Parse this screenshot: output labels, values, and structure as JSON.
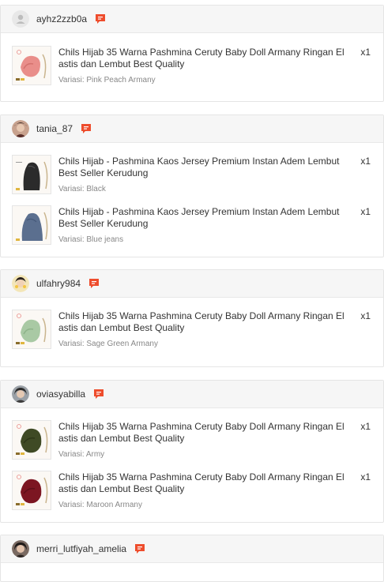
{
  "orders": [
    {
      "user": "ayhz2zzb0a",
      "avatar": "default-avatar",
      "items": [
        {
          "title": "Chils Hijab 35 Warna Pashmina Ceruty Baby Doll Armany Ringan El astis dan Lembut Best Quality",
          "variant": "Variasi: Pink Peach Armany",
          "qty": "x1",
          "color": "#e98e8a"
        }
      ]
    },
    {
      "user": "tania_87",
      "avatar": "photo-avatar",
      "items": [
        {
          "title": "Chils Hijab - Pashmina Kaos Jersey Premium Instan Adem Lembut Best Seller Kerudung",
          "variant": "Variasi: Black",
          "qty": "x1",
          "color": "#2b2b2b"
        },
        {
          "title": "Chils Hijab - Pashmina Kaos Jersey Premium Instan Adem Lembut Best Seller Kerudung",
          "variant": "Variasi: Blue jeans",
          "qty": "x1",
          "color": "#5b6f8f"
        }
      ]
    },
    {
      "user": "ulfahry984",
      "avatar": "photo-avatar",
      "items": [
        {
          "title": "Chils Hijab 35 Warna Pashmina Ceruty Baby Doll Armany Ringan El astis dan Lembut Best Quality",
          "variant": "Variasi: Sage Green Armany",
          "qty": "x1",
          "color": "#a9c9a4"
        }
      ]
    },
    {
      "user": "oviasyabilla",
      "avatar": "photo-avatar",
      "items": [
        {
          "title": "Chils Hijab 35 Warna Pashmina Ceruty Baby Doll Armany Ringan El astis dan Lembut Best Quality",
          "variant": "Variasi: Army",
          "qty": "x1",
          "color": "#3f4a25"
        },
        {
          "title": "Chils Hijab 35 Warna Pashmina Ceruty Baby Doll Armany Ringan El astis dan Lembut Best Quality",
          "variant": "Variasi: Maroon Armany",
          "qty": "x1",
          "color": "#7c1622"
        }
      ]
    },
    {
      "user": "merri_lutfiyah_amelia",
      "avatar": "photo-avatar",
      "items": []
    }
  ],
  "colors": {
    "chat_icon": "#ee4d2d",
    "header_bg": "#f6f6f6"
  },
  "icons": {
    "chat": "chat-bubble-icon"
  }
}
